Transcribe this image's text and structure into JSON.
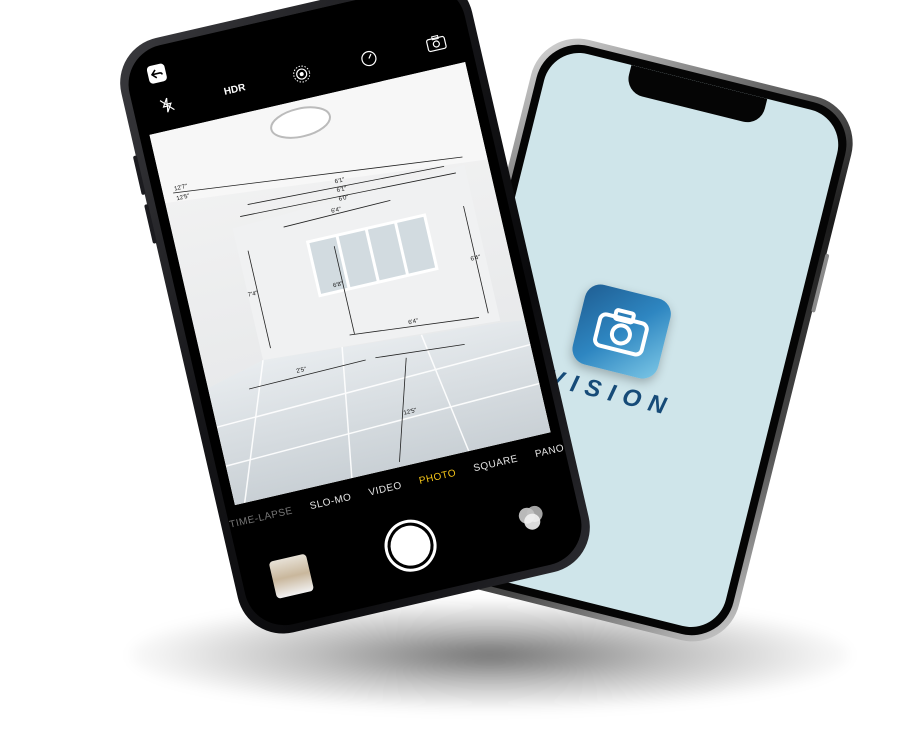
{
  "camera": {
    "top_controls": {
      "flash_icon": "flash-off-icon",
      "hdr_label": "HDR",
      "live_icon": "live-photo-icon",
      "timer_icon": "timer-icon",
      "flip_icon": "camera-flip-icon"
    },
    "modes": [
      "TIME-LAPSE",
      "SLO-MO",
      "VIDEO",
      "PHOTO",
      "SQUARE",
      "PANO"
    ],
    "active_mode": "PHOTO",
    "measurements": [
      "6'1\"",
      "6'1\"",
      "6'0\"",
      "6'4\"",
      "6'4\"",
      "6'4\"",
      "12'7\"",
      "12'5\"",
      "2'5\"",
      "7'4\"",
      "6'8\"",
      "12'5\""
    ]
  },
  "splash": {
    "brand_text": "VISION",
    "colors": {
      "background": "#cfe5ea",
      "tile": "#2e86c1",
      "text": "#164b78"
    }
  }
}
